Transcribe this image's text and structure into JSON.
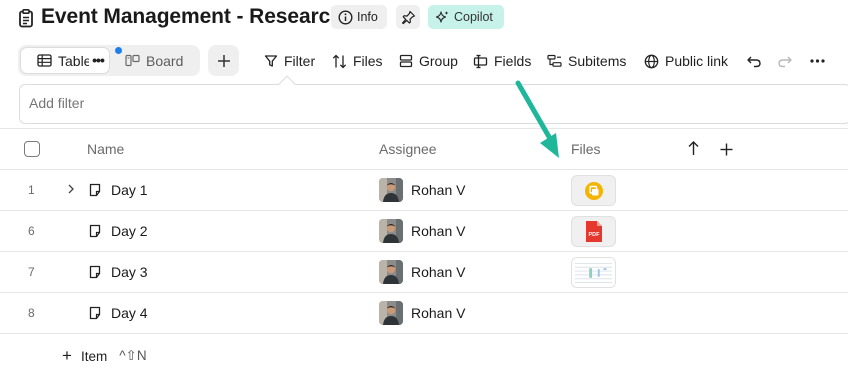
{
  "header": {
    "title": "Event Management - Research",
    "info_label": "Info",
    "copilot_label": "Copilot"
  },
  "toolbar": {
    "views": [
      {
        "label": "Table",
        "active": true
      },
      {
        "label": "Board",
        "active": false
      }
    ],
    "filter_label": "Filter",
    "files_label": "Files",
    "group_label": "Group",
    "fields_label": "Fields",
    "subitems_label": "Subitems",
    "public_link_label": "Public link"
  },
  "filter_bar": {
    "placeholder": "Add filter"
  },
  "table": {
    "columns": [
      "Name",
      "Assignee",
      "Files"
    ],
    "rows": [
      {
        "num": "1",
        "name": "Day 1",
        "assignee": "Rohan V",
        "file": "slides-icon",
        "expandable": true
      },
      {
        "num": "6",
        "name": "Day 2",
        "assignee": "Rohan V",
        "file": "pdf-icon",
        "expandable": false
      },
      {
        "num": "7",
        "name": "Day 3",
        "assignee": "Rohan V",
        "file": "spreadsheet-thumbnail",
        "expandable": false
      },
      {
        "num": "8",
        "name": "Day 4",
        "assignee": "Rohan V",
        "file": null,
        "expandable": false
      }
    ],
    "pdf_label": "PDF"
  },
  "footer": {
    "add_item_label": "Item",
    "add_item_shortcut": "^⇧N"
  },
  "colors": {
    "accent_teal": "#1fb79a",
    "copilot_bg": "#c7f2ea",
    "dot_blue": "#1b7ff0",
    "pdf_red": "#e5372e",
    "slides_yellow": "#f4b400"
  }
}
